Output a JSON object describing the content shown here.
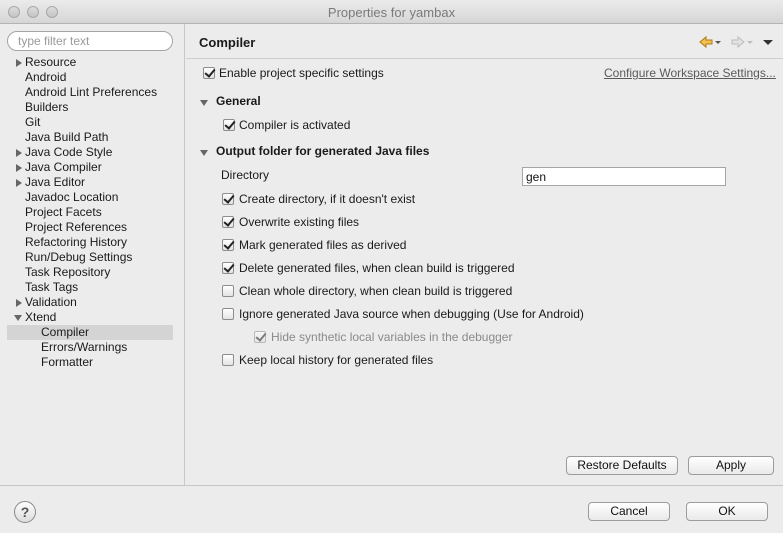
{
  "window": {
    "title": "Properties for yambax"
  },
  "filter": {
    "placeholder": "type filter text",
    "value": ""
  },
  "tree": {
    "items": [
      {
        "label": "Resource",
        "expandable": true
      },
      {
        "label": "Android"
      },
      {
        "label": "Android Lint Preferences"
      },
      {
        "label": "Builders"
      },
      {
        "label": "Git"
      },
      {
        "label": "Java Build Path"
      },
      {
        "label": "Java Code Style",
        "expandable": true
      },
      {
        "label": "Java Compiler",
        "expandable": true
      },
      {
        "label": "Java Editor",
        "expandable": true
      },
      {
        "label": "Javadoc Location"
      },
      {
        "label": "Project Facets"
      },
      {
        "label": "Project References"
      },
      {
        "label": "Refactoring History"
      },
      {
        "label": "Run/Debug Settings"
      },
      {
        "label": "Task Repository"
      },
      {
        "label": "Task Tags"
      },
      {
        "label": "Validation",
        "expandable": true
      },
      {
        "label": "Xtend",
        "expanded": true
      },
      {
        "label": "Compiler",
        "selected": true
      },
      {
        "label": "Errors/Warnings"
      },
      {
        "label": "Formatter"
      }
    ]
  },
  "page": {
    "title": "Compiler",
    "enable_specific": {
      "label": "Enable project specific settings",
      "checked": true
    },
    "configure_link": "Configure Workspace Settings...",
    "general_section": "General",
    "compiler_activated": {
      "label": "Compiler is activated",
      "checked": true
    },
    "output_section": "Output folder for generated Java files",
    "directory_label": "Directory",
    "directory_value": "gen",
    "options": [
      {
        "label": "Create directory, if it doesn't exist",
        "checked": true
      },
      {
        "label": "Overwrite existing files",
        "checked": true
      },
      {
        "label": "Mark generated files as derived",
        "checked": true
      },
      {
        "label": "Delete generated files, when clean build is triggered",
        "checked": true
      },
      {
        "label": "Clean whole directory, when clean build is triggered",
        "checked": false
      },
      {
        "label": "Ignore generated Java source when debugging (Use for Android)",
        "checked": false
      },
      {
        "label": "Hide synthetic local variables in the debugger",
        "checked": true,
        "disabled": true
      },
      {
        "label": "Keep local history for generated files",
        "checked": false
      }
    ],
    "restore_defaults": "Restore Defaults",
    "apply": "Apply"
  },
  "footer": {
    "help": "?",
    "cancel": "Cancel",
    "ok": "OK"
  },
  "colors": {
    "selection": "#d4d4d4",
    "back_arrow": "#e8a317"
  }
}
